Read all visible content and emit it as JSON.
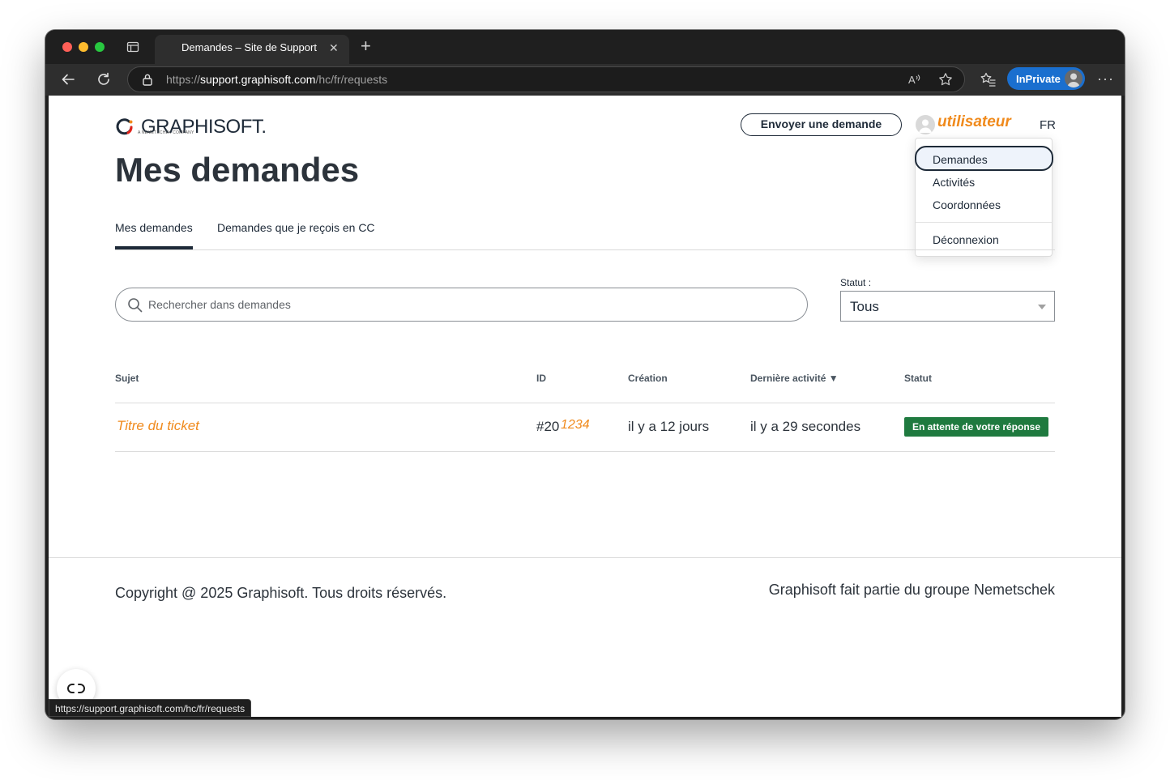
{
  "browser": {
    "tab_title": "Demandes – Site de Support",
    "address": {
      "scheme": "https://",
      "host": "support.graphisoft.com",
      "path": "/hc/fr/requests"
    },
    "inprivate_label": "InPrivate",
    "status_url": "https://support.graphisoft.com/hc/fr/requests"
  },
  "header": {
    "logo_text": "GRAPHISOFT.",
    "logo_subtitle": "A NEMETSCHEK COMPANY",
    "submit_button": "Envoyer une demande",
    "user_name": "utilisateur",
    "language": "FR"
  },
  "user_menu": {
    "items": [
      "Demandes",
      "Activités",
      "Coordonnées"
    ],
    "logout": "Déconnexion"
  },
  "page": {
    "title": "Mes demandes",
    "tabs": [
      "Mes demandes",
      "Demandes que je reçois en CC"
    ],
    "active_tab": "Mes demandes"
  },
  "search": {
    "placeholder": "Rechercher dans demandes",
    "value": ""
  },
  "status_filter": {
    "label": "Statut :",
    "selected": "Tous"
  },
  "table": {
    "headers": {
      "subject": "Sujet",
      "id": "ID",
      "created": "Création",
      "last_activity": "Dernière activité",
      "sort_indicator": "▼",
      "status": "Statut"
    },
    "rows": [
      {
        "subject": "Titre du ticket",
        "id_prefix": "#20",
        "id_suffix": "1234",
        "created": "il y a 12 jours",
        "last_activity": "il y a 29 secondes",
        "status": "En attente de votre réponse"
      }
    ]
  },
  "footer": {
    "copyright": "Copyright @ 2025 Graphisoft. Tous droits réservés.",
    "group": "Graphisoft fait partie du groupe Nemetschek"
  },
  "colors": {
    "accent_orange": "#f08a1c",
    "status_green": "#1f7a3f",
    "text_dark": "#1e2a38",
    "inprivate_blue": "#1a6fcf"
  }
}
